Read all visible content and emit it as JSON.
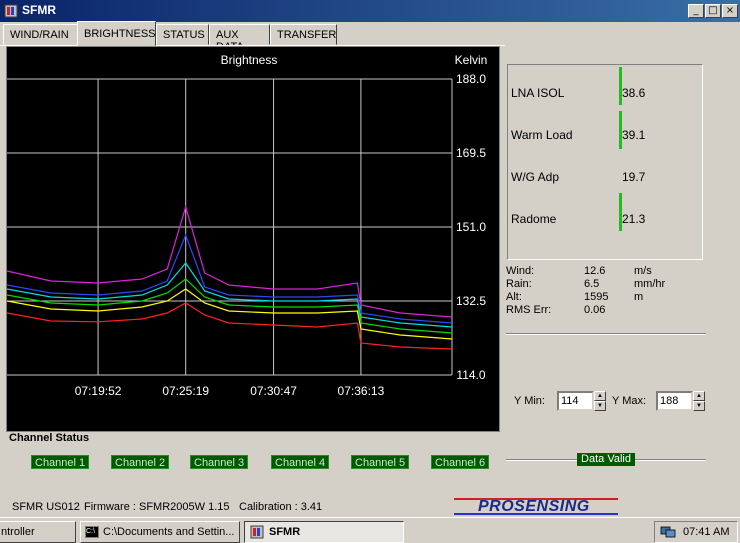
{
  "window": {
    "title": "SFMR",
    "caption_buttons": [
      "_",
      "□",
      "×"
    ]
  },
  "tabs": [
    {
      "label": "WIND/RAIN",
      "active": false
    },
    {
      "label": "BRIGHTNESS",
      "active": true
    },
    {
      "label": "STATUS",
      "active": false
    },
    {
      "label": "AUX DATA",
      "active": false
    },
    {
      "label": "TRANSFER",
      "active": false
    }
  ],
  "chart_data": {
    "type": "line",
    "title": "Brightness",
    "ylabel": "Kelvin",
    "ylim": [
      114.0,
      188.0
    ],
    "y_ticks": [
      "188.0",
      "169.5",
      "151.0",
      "132.5",
      "114.0"
    ],
    "x_ticks": [
      "07:19:52",
      "07:25:19",
      "07:30:47",
      "07:36:13"
    ],
    "xlim": [
      "07:14:12",
      "07:41:53"
    ],
    "grid": true,
    "series": [
      {
        "name": "Channel 1",
        "color": "#ff2222",
        "x": [
          "07:14:12",
          "07:16:56",
          "07:19:52",
          "07:22:36",
          "07:24:10",
          "07:25:19",
          "07:26:30",
          "07:28:00",
          "07:30:47",
          "07:33:30",
          "07:36:00",
          "07:36:13",
          "07:38:40",
          "07:41:53"
        ],
        "values": [
          129.5,
          127.5,
          127.3,
          128.0,
          129.5,
          132.0,
          129.0,
          127.0,
          126.5,
          126.0,
          127.0,
          122.0,
          121.0,
          120.5
        ]
      },
      {
        "name": "Channel 2",
        "color": "#ffff00",
        "x": [
          "07:14:12",
          "07:16:56",
          "07:19:52",
          "07:22:36",
          "07:24:10",
          "07:25:19",
          "07:26:30",
          "07:28:00",
          "07:30:47",
          "07:33:30",
          "07:36:00",
          "07:36:13",
          "07:38:40",
          "07:41:53"
        ],
        "values": [
          132.5,
          130.5,
          130.0,
          131.0,
          132.5,
          135.5,
          132.0,
          130.0,
          129.5,
          129.5,
          130.0,
          125.5,
          124.0,
          123.0
        ]
      },
      {
        "name": "Channel 3",
        "color": "#00dd00",
        "x": [
          "07:14:12",
          "07:16:56",
          "07:19:52",
          "07:22:36",
          "07:24:10",
          "07:25:19",
          "07:26:30",
          "07:28:00",
          "07:30:47",
          "07:33:30",
          "07:36:00",
          "07:36:13",
          "07:38:40",
          "07:41:53"
        ],
        "values": [
          134.0,
          132.0,
          131.5,
          132.5,
          134.5,
          138.0,
          133.5,
          131.5,
          131.0,
          131.0,
          131.5,
          127.0,
          125.5,
          124.5
        ]
      },
      {
        "name": "Channel 4",
        "color": "#00dddd",
        "x": [
          "07:14:12",
          "07:16:56",
          "07:19:52",
          "07:22:36",
          "07:24:10",
          "07:25:19",
          "07:26:30",
          "07:28:00",
          "07:30:47",
          "07:33:30",
          "07:36:00",
          "07:36:13",
          "07:38:40",
          "07:41:53"
        ],
        "values": [
          135.5,
          133.5,
          133.0,
          134.0,
          136.5,
          142.0,
          135.0,
          133.0,
          132.5,
          132.5,
          133.0,
          128.5,
          127.0,
          126.0
        ]
      },
      {
        "name": "Channel 5",
        "color": "#3344ff",
        "x": [
          "07:14:12",
          "07:16:56",
          "07:19:52",
          "07:22:36",
          "07:24:10",
          "07:25:19",
          "07:26:30",
          "07:28:00",
          "07:30:47",
          "07:33:30",
          "07:36:00",
          "07:36:13",
          "07:38:40",
          "07:41:53"
        ],
        "values": [
          136.5,
          134.5,
          134.0,
          135.0,
          137.5,
          149.0,
          136.0,
          134.0,
          133.5,
          133.5,
          134.0,
          129.5,
          128.0,
          127.0
        ]
      },
      {
        "name": "Channel 6",
        "color": "#dd22dd",
        "x": [
          "07:14:12",
          "07:16:56",
          "07:19:52",
          "07:22:36",
          "07:24:10",
          "07:25:19",
          "07:26:30",
          "07:28:00",
          "07:30:47",
          "07:33:30",
          "07:36:00",
          "07:36:13",
          "07:38:40",
          "07:41:53"
        ],
        "values": [
          140.0,
          137.5,
          137.0,
          138.0,
          140.5,
          156.0,
          139.5,
          136.5,
          135.5,
          135.5,
          137.0,
          131.5,
          129.5,
          128.5
        ]
      }
    ]
  },
  "channel_status": {
    "title": "Channel Status",
    "channels": [
      "Channel 1",
      "Channel 2",
      "Channel 3",
      "Channel 4",
      "Channel 5",
      "Channel 6"
    ]
  },
  "aux": {
    "items": [
      {
        "label": "LNA ISOL",
        "value": "38.6",
        "bar": true
      },
      {
        "label": "Warm Load",
        "value": "39.1",
        "bar": true
      },
      {
        "label": "W/G Adp",
        "value": "19.7",
        "bar": false
      },
      {
        "label": "Radome",
        "value": "21.3",
        "bar": true
      }
    ]
  },
  "met": [
    {
      "label": "Wind:",
      "value": "12.6",
      "unit": "m/s"
    },
    {
      "label": "Rain:",
      "value": "6.5",
      "unit": "mm/hr"
    },
    {
      "label": "Alt:",
      "value": "1595",
      "unit": "m"
    },
    {
      "label": "RMS Err:",
      "value": "0.06",
      "unit": ""
    }
  ],
  "yrange": {
    "ymin_label": "Y Min:",
    "ymin_value": "114",
    "ymax_label": "Y Max:",
    "ymax_value": "188"
  },
  "data_valid": "Data Valid",
  "status": {
    "unit": "SFMR US012",
    "firmware": "Firmware : SFMR2005W 1.15",
    "calibration": "Calibration :  3.41"
  },
  "logo_text": "ProSensing",
  "taskbar": {
    "items": [
      {
        "label": "ntroller",
        "active": false
      },
      {
        "label": "C:\\Documents and Settin...",
        "active": false
      },
      {
        "label": "SFMR",
        "active": true
      }
    ],
    "clock": "07:41 AM"
  }
}
